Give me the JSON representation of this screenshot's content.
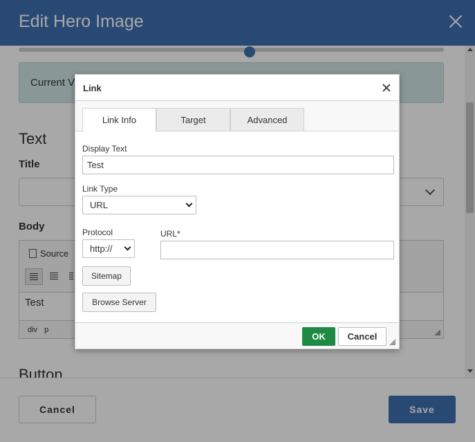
{
  "background_modal": {
    "title": "Edit Hero Image",
    "current_text": "Current V",
    "section_text": "Text",
    "title_label": "Title",
    "body_label": "Body",
    "source_label": "Source",
    "editor_content": "Test",
    "path": [
      "div",
      "p"
    ],
    "section_button_partial": "Button",
    "cancel_label": "Cancel",
    "save_label": "Save",
    "header_color": "#3f6fb2"
  },
  "link_dialog": {
    "title": "Link",
    "tabs": [
      {
        "label": "Link Info",
        "active": true
      },
      {
        "label": "Target",
        "active": false
      },
      {
        "label": "Advanced",
        "active": false
      }
    ],
    "display_text_label": "Display Text",
    "display_text_value": "Test",
    "link_type_label": "Link Type",
    "link_type_value": "URL",
    "protocol_label": "Protocol",
    "protocol_value": "http://",
    "url_label": "URL*",
    "url_value": "",
    "sitemap_label": "Sitemap",
    "browse_server_label": "Browse Server",
    "ok_label": "OK",
    "cancel_label": "Cancel",
    "ok_color": "#1f8a43"
  }
}
